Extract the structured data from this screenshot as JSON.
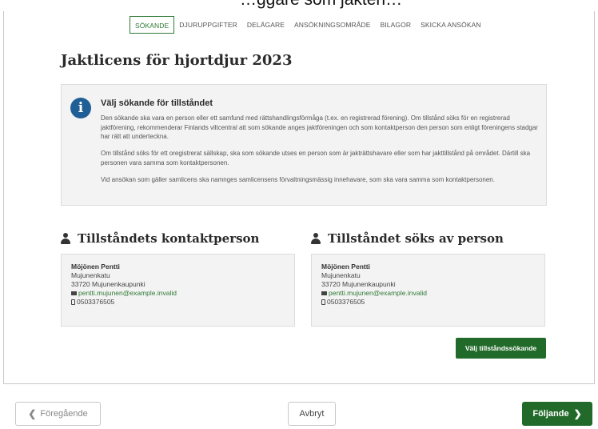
{
  "top_strip_text": "…ggare som jakten…",
  "steps": [
    {
      "label": "SÖKANDE",
      "active": true
    },
    {
      "label": "DJURUPPGIFTER",
      "active": false
    },
    {
      "label": "DELÄGARE",
      "active": false
    },
    {
      "label": "ANSÖKNINGSOMRÅDE",
      "active": false
    },
    {
      "label": "BILAGOR",
      "active": false
    },
    {
      "label": "SKICKA ANSÖKAN",
      "active": false
    }
  ],
  "page_title": "Jaktlicens för hjortdjur 2023",
  "info": {
    "icon": "info-icon",
    "heading": "Välj sökande för tillståndet",
    "paragraphs": [
      "Den sökande ska vara en person eller ett samfund med rättshandlingsförmåga (t.ex. en registrerad förening). Om tillstånd söks för en registrerad jaktförening, rekommenderar Finlands viltcentral att som sökande anges jaktföreningen och som kontaktperson den person som enligt föreningens stadgar har rätt att underteckna.",
      "Om tillstånd söks för ett oregistrerat sällskap, ska som sökande utses en person som är jakträttshavare eller som har jakttillstånd på området. Därtill ska personen vara samma som kontaktpersonen.",
      "Vid ansökan som gäller samlicens ska namnges samlicensens förvaltningsmässig innehavare, som ska vara samma som kontaktpersonen."
    ]
  },
  "contact_section": {
    "title": "Tillståndets kontaktperson",
    "icon": "user-icon",
    "name": "Möjönen Pentti",
    "street": "Mujunenkatu",
    "postal": "33720 Mujunenkaupunki",
    "email": "pentti.mujunen@example.invalid",
    "phone": "0503376505"
  },
  "applicant_section": {
    "title": "Tillståndet söks av person",
    "icon": "user-icon",
    "name": "Möjönen Pentti",
    "street": "Mujunenkatu",
    "postal": "33720 Mujunenkaupunki",
    "email": "pentti.mujunen@example.invalid",
    "phone": "0503376505",
    "choose_button": "Välj tillståndssökande"
  },
  "footer": {
    "prev_label": "Föregående",
    "cancel_label": "Avbryt",
    "next_label": "Följande"
  },
  "colors": {
    "primary_green": "#226a2a",
    "info_blue": "#1f5f96"
  }
}
